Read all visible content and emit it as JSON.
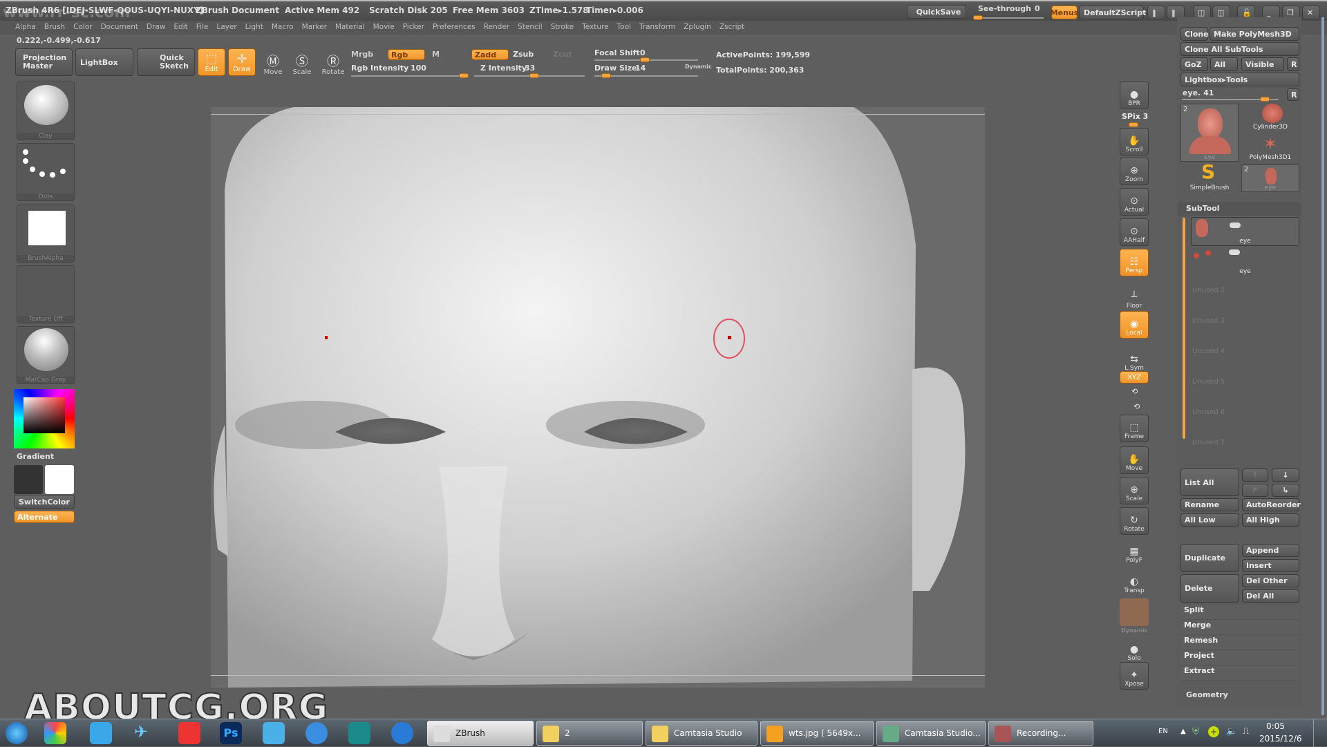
{
  "titlebar": {
    "app": "ZBrush 4R6 [IDEJ-SLWF-QOUS-UQYI-NUXY]",
    "document": "ZBrush Document",
    "active_mem": "Active Mem 492",
    "scratch_disk": "Scratch Disk 205",
    "free_mem": "Free Mem 3603",
    "ztime": "ZTime▸1.578",
    "timer": "Timer▸0.006",
    "quicksave": "QuickSave",
    "see_through_label": "See-through",
    "see_through_value": "0",
    "see_through_fraction": 0.05,
    "menus": "Menus",
    "zscript": "DefaultZScript",
    "watermark": "www.rr-sc.com"
  },
  "menubar": [
    "Alpha",
    "Brush",
    "Color",
    "Document",
    "Draw",
    "Edit",
    "File",
    "Layer",
    "Light",
    "Macro",
    "Marker",
    "Material",
    "Movie",
    "Picker",
    "Preferences",
    "Render",
    "Stencil",
    "Stroke",
    "Texture",
    "Tool",
    "Transform",
    "Zplugin",
    "Zscript"
  ],
  "coords": "0.222,-0.499,-0.617",
  "toolbar": {
    "projection_master": "Projection Master",
    "lightbox": "LightBox",
    "quick_sketch": "Quick Sketch",
    "edit": "Edit",
    "draw": "Draw",
    "move": "Move",
    "scale": "Scale",
    "rotate": "Rotate",
    "mrgb": "Mrgb",
    "rgb": "Rgb",
    "m": "M",
    "rgb_intensity_label": "Rgb Intensity",
    "rgb_intensity": "100",
    "zadd": "Zadd",
    "zsub": "Zsub",
    "zcut": "Zcut",
    "z_intensity_label": "Z Intensity",
    "z_intensity": "33",
    "focal_shift_label": "Focal Shift",
    "focal_shift": "0",
    "draw_size_label": "Draw Size",
    "draw_size": "14",
    "dynamic": "Dynamic",
    "active_points": "ActivePoints: 199,599",
    "total_points": "TotalPoints: 200,363"
  },
  "left_shelf": {
    "brush": "Clay",
    "stroke": "Dots",
    "alpha": "BrushAlpha",
    "texture": "Texture Off",
    "material": "MatCap Gray",
    "gradient": "Gradient",
    "switch_color": "SwitchColor",
    "alternate": "Alternate"
  },
  "right_strip": [
    {
      "label": "BPR",
      "on": false,
      "icon": "bpr-icon",
      "g": "●"
    },
    {
      "label": "Scroll",
      "on": false,
      "icon": "hand-icon",
      "g": "✋"
    },
    {
      "label": "Zoom",
      "on": false,
      "icon": "magnifier-icon",
      "g": "⊕"
    },
    {
      "label": "Actual",
      "on": false,
      "icon": "actual-size-icon",
      "g": "⊙"
    },
    {
      "label": "AAHalf",
      "on": false,
      "icon": "aahalf-icon",
      "g": "⊙"
    },
    {
      "label": "Persp",
      "on": true,
      "icon": "perspective-icon",
      "g": "☷"
    },
    {
      "label": "Floor",
      "on": false,
      "icon": "floor-icon",
      "g": "┴"
    },
    {
      "label": "Local",
      "on": true,
      "icon": "local-icon",
      "g": "◉"
    },
    {
      "label": "L.Sym",
      "on": false,
      "icon": "symmetry-icon",
      "g": "⇆"
    },
    {
      "label": "Frame",
      "on": false,
      "icon": "frame-icon",
      "g": "⬚"
    },
    {
      "label": "Move",
      "on": false,
      "icon": "move-hand-icon",
      "g": "✋"
    },
    {
      "label": "Scale",
      "on": false,
      "icon": "scale-icon",
      "g": "⊕"
    },
    {
      "label": "Rotate",
      "on": false,
      "icon": "rotate-icon",
      "g": "↻"
    },
    {
      "label": "PolyF",
      "on": false,
      "icon": "polyframe-icon",
      "g": "▦"
    },
    {
      "label": "Transp",
      "on": false,
      "icon": "transparency-icon",
      "g": "◐"
    },
    {
      "label": "Solo",
      "on": false,
      "icon": "solo-icon",
      "g": "●"
    },
    {
      "label": "Xpose",
      "on": false,
      "icon": "xpose-icon",
      "g": "✦"
    }
  ],
  "spix": "SPix 3",
  "xyz": "XYZ",
  "dynamic2": "Dynamic",
  "right_panel": {
    "clone": "Clone",
    "make_polymesh": "Make PolyMesh3D",
    "clone_all": "Clone All SubTools",
    "goz": "GoZ",
    "all": "All",
    "visible": "Visible",
    "r": "R",
    "lightbox_tools": "Lightbox▸Tools",
    "current_tool": "eye. 41",
    "tools": [
      {
        "name": "eye",
        "count": "2"
      },
      {
        "name": "Cylinder3D"
      },
      {
        "name": "PolyMesh3D1"
      },
      {
        "name": "SimpleBrush"
      },
      {
        "name": "eye",
        "count": "2"
      }
    ],
    "subtool_header": "SubTool",
    "subtools": [
      "eye",
      "eye"
    ],
    "unused": [
      "Unused 2",
      "Unused 3",
      "Unused 4",
      "Unused 5",
      "Unused 6",
      "Unused 7"
    ],
    "list_all": "List All",
    "rename": "Rename",
    "auto_reorder": "AutoReorder",
    "all_low": "All Low",
    "all_high": "All High",
    "duplicate": "Duplicate",
    "append": "Append",
    "insert": "Insert",
    "delete": "Delete",
    "del_other": "Del Other",
    "del_all": "Del All",
    "sections": [
      "Split",
      "Merge",
      "Remesh",
      "Project",
      "Extract"
    ],
    "geometry": "Geometry"
  },
  "overlay_watermark": "ABOUTCG.ORG",
  "taskbar": {
    "apps": [
      {
        "name": "ZBrush",
        "icon": "zbrush-icon"
      },
      {
        "name": "2",
        "icon": "folder-icon"
      },
      {
        "name": "Camtasia Studio",
        "icon": "folder-icon"
      },
      {
        "name": "wts.jpg ( 5649x...",
        "icon": "image-viewer-icon"
      },
      {
        "name": "Camtasia Studio...",
        "icon": "camtasia-icon"
      },
      {
        "name": "Recording...",
        "icon": "recording-icon"
      }
    ],
    "lang": "EN",
    "time": "0:05",
    "date": "2015/12/6"
  }
}
